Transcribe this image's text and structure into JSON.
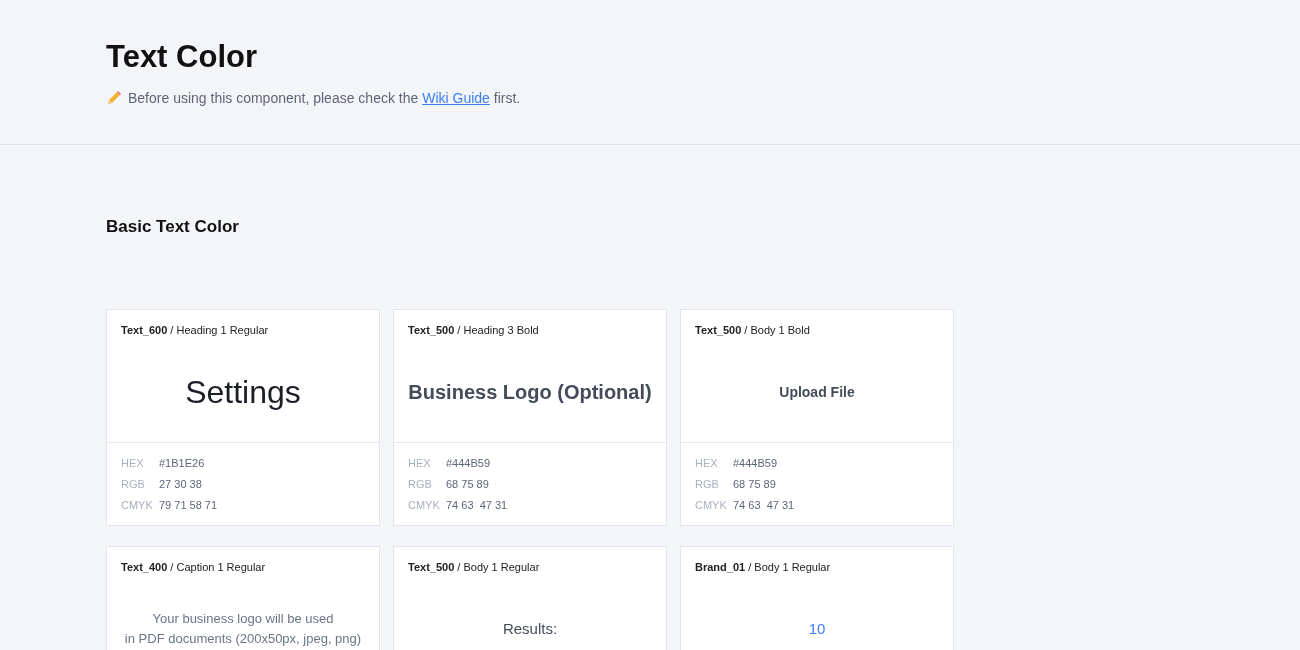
{
  "header": {
    "title": "Text Color",
    "notice": {
      "before": "Before using this component, please check the",
      "link": "Wiki Guide",
      "after": "first."
    }
  },
  "section": {
    "title": "Basic Text Color",
    "separator": "/",
    "cards": [
      {
        "token": "Text_600",
        "style_name": "Heading 1 Regular",
        "kind": "heading1",
        "color": "#1b1e26",
        "sample": [
          "Settings"
        ],
        "specs": [
          {
            "label": "HEX",
            "value": "#1B1E26"
          },
          {
            "label": "RGB",
            "value": "27 30 38"
          },
          {
            "label": "CMYK",
            "value": "79 71 58 71"
          }
        ]
      },
      {
        "token": "Text_500",
        "style_name": "Heading 3 Bold",
        "kind": "heading3",
        "color": "#444b59",
        "sample": [
          "Business Logo (Optional)"
        ],
        "specs": [
          {
            "label": "HEX",
            "value": "#444B59"
          },
          {
            "label": "RGB",
            "value": "68 75 89"
          },
          {
            "label": "CMYK",
            "value": "74 63  47 31"
          }
        ]
      },
      {
        "token": "Text_500",
        "style_name": "Body 1 Bold",
        "kind": "body1bold",
        "color": "#444b59",
        "sample": [
          "Upload File"
        ],
        "specs": [
          {
            "label": "HEX",
            "value": "#444B59"
          },
          {
            "label": "RGB",
            "value": "68 75 89"
          },
          {
            "label": "CMYK",
            "value": "74 63  47 31"
          }
        ]
      },
      {
        "token": "Text_400",
        "style_name": "Caption 1 Regular",
        "kind": "caption1",
        "color": "#6b7588",
        "sample": [
          "Your business logo will be used",
          "in PDF documents (200x50px, jpeg, png)"
        ]
      },
      {
        "token": "Text_500",
        "style_name": "Body 1 Regular",
        "kind": "body1",
        "color": "#444b59",
        "sample": [
          "Results:"
        ]
      },
      {
        "token": "Brand_01",
        "style_name": "Body 1 Regular",
        "kind": "body1",
        "color": "#3d7ef5",
        "sample": [
          "10"
        ]
      }
    ]
  }
}
